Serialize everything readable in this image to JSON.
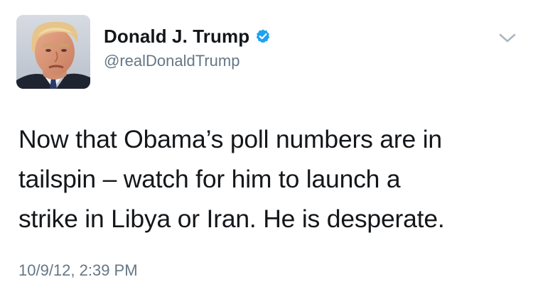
{
  "tweet": {
    "author": {
      "display_name": "Donald J. Trump",
      "handle": "@realDonaldTrump",
      "verified": true,
      "avatar_icon": "profile-photo"
    },
    "text": "Now that Obama’s poll numbers are in\ntailspin – watch for him to launch a\nstrike in Libya or Iran.  He is desperate.",
    "timestamp": "10/9/12, 2:39 PM",
    "menu_icon": "chevron-down-icon"
  },
  "colors": {
    "text_primary": "#14171a",
    "text_secondary": "#657786",
    "verified_blue": "#1da1f2",
    "chevron": "#aab8c2"
  }
}
